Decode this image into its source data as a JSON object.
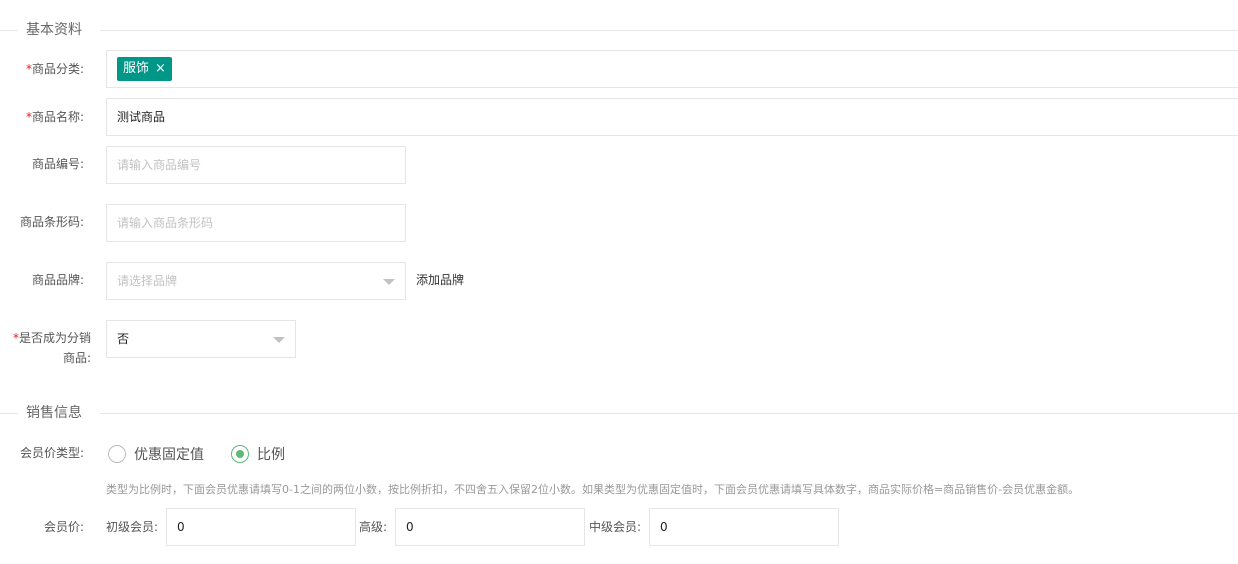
{
  "sections": {
    "basic": "基本资料",
    "sales": "销售信息"
  },
  "fields": {
    "category": {
      "label": "商品分类:",
      "tag": "服饰",
      "tag_close": "×",
      "required": "*"
    },
    "name": {
      "label": "商品名称:",
      "value": "测试商品",
      "required": "*"
    },
    "code": {
      "label": "商品编号:",
      "placeholder": "请输入商品编号"
    },
    "barcode": {
      "label": "商品条形码:",
      "placeholder": "请输入商品条形码"
    },
    "brand": {
      "label": "商品品牌:",
      "placeholder": "请选择品牌",
      "add_link": "添加品牌"
    },
    "distribution": {
      "label_line1": "是否成为分销",
      "label_line2": "商品:",
      "value": "否",
      "required": "*"
    },
    "member_price_type": {
      "label": "会员价类型:",
      "options": [
        "优惠固定值",
        "比例"
      ],
      "selected": "比例"
    },
    "hint": "类型为比例时，下面会员优惠请填写0-1之间的两位小数，按比例折扣，不四舍五入保留2位小数。如果类型为优惠固定值时，下面会员优惠请填写具体数字，商品实际价格=商品销售价-会员优惠金额。",
    "member_price": {
      "label": "会员价:",
      "levels": [
        {
          "label": "初级会员:",
          "value": "0"
        },
        {
          "label": "高级:",
          "value": "0"
        },
        {
          "label": "中级会员:",
          "value": "0"
        }
      ]
    }
  },
  "colors": {
    "tag_bg": "#009688",
    "radio_on": "#5fb878",
    "required": "#e02020"
  }
}
